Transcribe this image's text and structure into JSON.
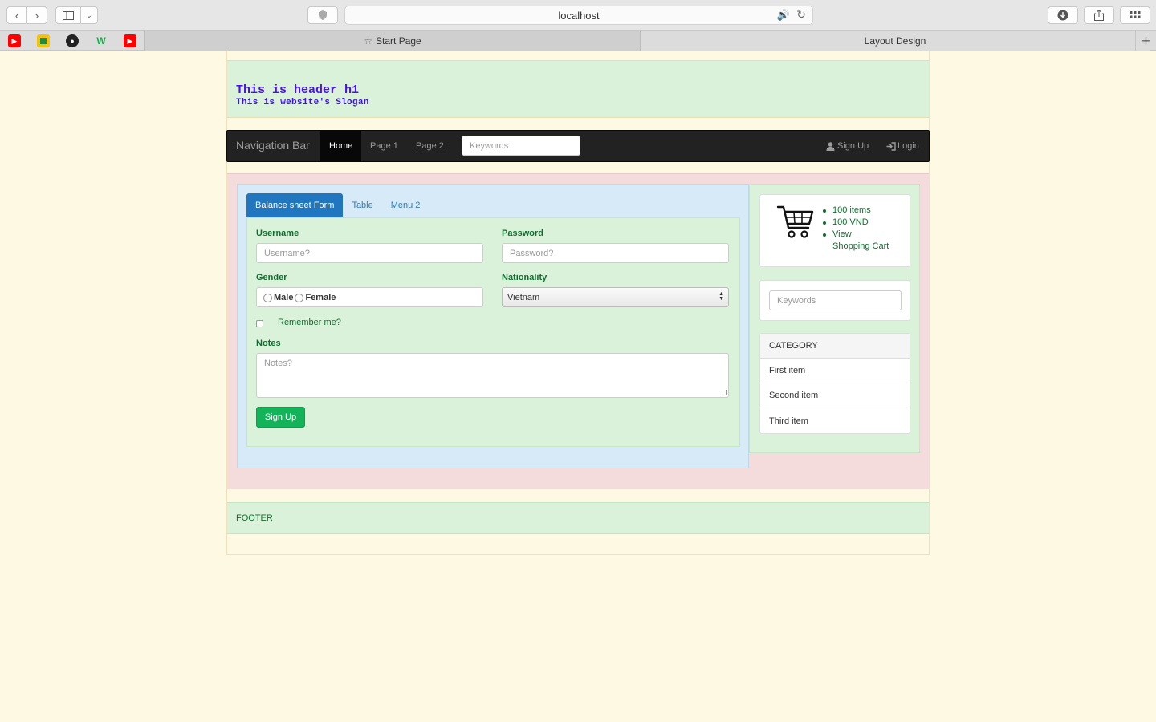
{
  "browser": {
    "url": "localhost",
    "tabs": [
      {
        "label": "Start Page",
        "icon": "star-icon"
      },
      {
        "label": "Layout Design"
      }
    ],
    "favorites": [
      "youtube-icon",
      "google-drive-icon",
      "github-icon",
      "w-icon",
      "youtube-icon"
    ]
  },
  "header": {
    "title": "This is header h1",
    "slogan": "This is website's Slogan"
  },
  "navbar": {
    "brand": "Navigation Bar",
    "links": [
      "Home",
      "Page 1",
      "Page 2"
    ],
    "active_link": "Home",
    "search_placeholder": "Keywords",
    "signup": "Sign Up",
    "login": "Login"
  },
  "main": {
    "tabs": [
      "Balance sheet Form",
      "Table",
      "Menu 2"
    ],
    "active_tab": "Balance sheet Form",
    "form": {
      "username_label": "Username",
      "username_placeholder": "Username?",
      "password_label": "Password",
      "password_placeholder": "Password?",
      "gender_label": "Gender",
      "gender_options": [
        "Male",
        "Female"
      ],
      "nationality_label": "Nationality",
      "nationality_value": "Vietnam",
      "remember_label": "Remember me?",
      "notes_label": "Notes",
      "notes_placeholder": "Notes?",
      "submit_label": "Sign Up"
    }
  },
  "sidebar": {
    "cart": {
      "items": [
        "100 items",
        "100 VND",
        "View"
      ],
      "link": "Shopping Cart"
    },
    "search_placeholder": "Keywords",
    "category": {
      "heading": "CATEGORY",
      "items": [
        "First item",
        "Second item",
        "Third item"
      ]
    }
  },
  "footer": {
    "text": "FOOTER"
  },
  "colors": {
    "page_background": "#fdf9e3",
    "header_title": "#4b0ff0",
    "green_text": "#116d2f",
    "primary_tab": "#2176c0",
    "signup_button": "#13b35a"
  }
}
